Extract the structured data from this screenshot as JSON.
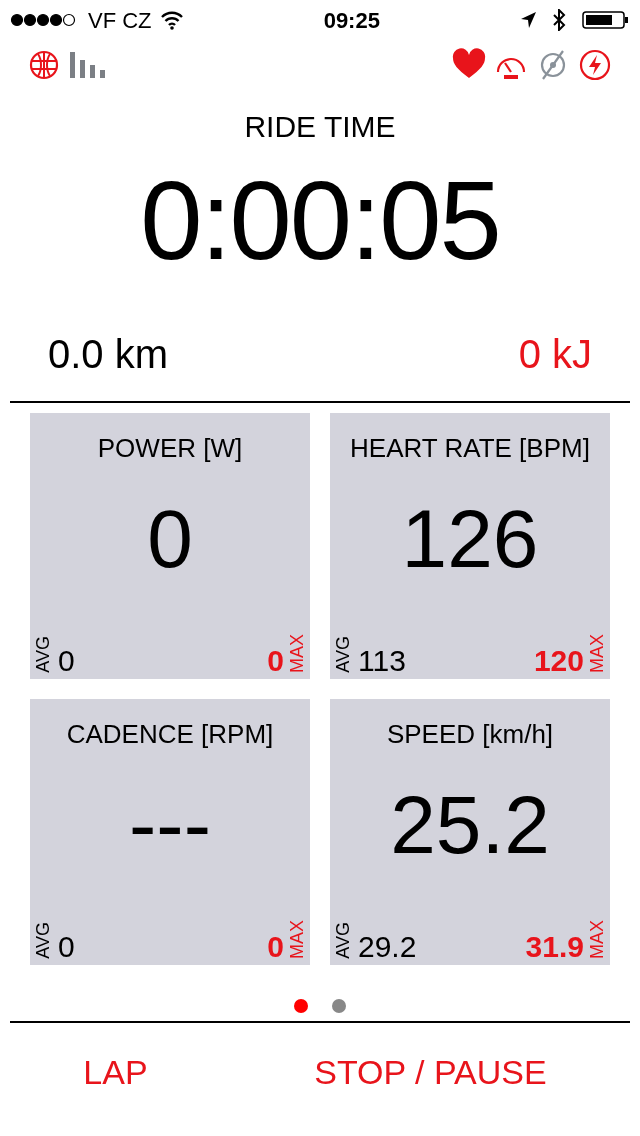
{
  "status_bar": {
    "carrier": "VF CZ",
    "time": "09:25"
  },
  "sensors": [
    {
      "kind": "heart",
      "connected": true
    },
    {
      "kind": "speed",
      "connected": true
    },
    {
      "kind": "cadence",
      "connected": false
    },
    {
      "kind": "power",
      "connected": true
    }
  ],
  "ride_time": {
    "label": "RIDE TIME",
    "value": "0:00:05"
  },
  "distance": "0.0 km",
  "energy": "0 kJ",
  "tiles": [
    {
      "title": "POWER [W]",
      "value": "0",
      "avg_label": "AVG",
      "avg": "0",
      "max": "0",
      "max_label": "MAX"
    },
    {
      "title": "HEART RATE [BPM]",
      "value": "126",
      "avg_label": "AVG",
      "avg": "113",
      "max": "120",
      "max_label": "MAX"
    },
    {
      "title": "CADENCE [RPM]",
      "value": "---",
      "avg_label": "AVG",
      "avg": "0",
      "max": "0",
      "max_label": "MAX"
    },
    {
      "title": "SPEED [km/h]",
      "value": "25.2",
      "avg_label": "AVG",
      "avg": "29.2",
      "max": "31.9",
      "max_label": "MAX"
    }
  ],
  "pages": [
    {
      "selected": true
    },
    {
      "selected": false
    }
  ],
  "buttons": [
    "LAP",
    "STOP / PAUSE"
  ]
}
